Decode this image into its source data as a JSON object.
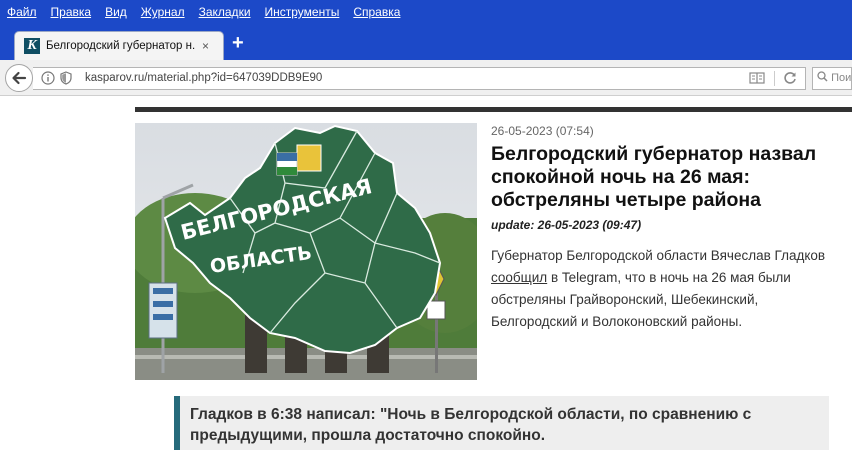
{
  "menu": {
    "items": [
      {
        "label": "Файл"
      },
      {
        "label": "Правка"
      },
      {
        "label": "Вид"
      },
      {
        "label": "Журнал"
      },
      {
        "label": "Закладки"
      },
      {
        "label": "Инструменты"
      },
      {
        "label": "Справка"
      }
    ]
  },
  "tab": {
    "title": "Белгородский губернатор н...",
    "favicon_letter": "K",
    "close": "×",
    "new_tab": "+"
  },
  "navbar": {
    "url": "kasparov.ru/material.php?id=647039DDB9E90",
    "search_placeholder": "Пои"
  },
  "image": {
    "sign_line1": "БЕЛГОРОДСКАЯ",
    "sign_line2": "ОБЛАСТЬ"
  },
  "article": {
    "date": "26-05-2023 (07:54)",
    "title": "Белгородский губернатор назвал спокойной ночь на 26 мая: обстреляны четыре района",
    "update": "update: 26-05-2023 (09:47)",
    "body_before": "Губернатор Белгородской области Вячеслав Гладков ",
    "body_link": "сообщил",
    "body_after": " в Telegram, что в ночь на 26 мая были обстреляны Грайворонский, Шебекинский, Белгородский и Волоконовский районы."
  },
  "quote": {
    "text": "Гладков в 6:38 написал: \"Ночь в Белгородской области, по сравнению с предыдущими, прошла достаточно спокойно."
  },
  "colors": {
    "menubar": "#1c49c8",
    "quote_border": "#266a7b",
    "map_green": "#2f6b48"
  }
}
